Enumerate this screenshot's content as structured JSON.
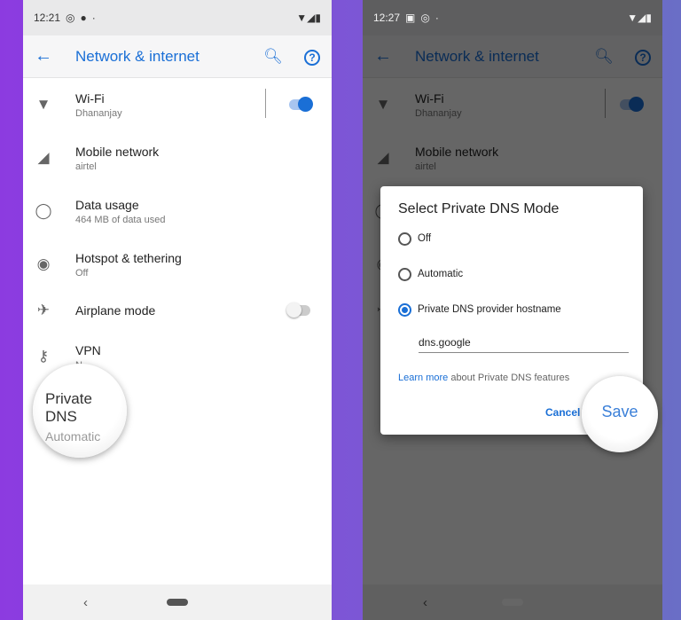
{
  "left_phone": {
    "status": {
      "time": "12:21"
    },
    "appbar": {
      "title": "Network & internet"
    },
    "items": [
      {
        "title": "Wi-Fi",
        "subtitle": "Dhananjay",
        "icon": "wifi-icon",
        "toggle": true
      },
      {
        "title": "Mobile network",
        "subtitle": "airtel",
        "icon": "signal-icon"
      },
      {
        "title": "Data usage",
        "subtitle": "464 MB of data used",
        "icon": "data-usage-icon"
      },
      {
        "title": "Hotspot & tethering",
        "subtitle": "Off",
        "icon": "hotspot-icon"
      },
      {
        "title": "Airplane mode",
        "icon": "airplane-icon",
        "toggle": false
      },
      {
        "title": "VPN",
        "subtitle": "N",
        "icon": "vpn-key-icon"
      }
    ],
    "magnifier": {
      "title": "Private DNS",
      "subtitle": "Automatic"
    }
  },
  "right_phone": {
    "status": {
      "time": "12:27"
    },
    "dialog": {
      "title": "Select Private DNS Mode",
      "options": [
        "Off",
        "Automatic",
        "Private DNS provider hostname"
      ],
      "selected": "Private DNS provider hostname",
      "hostname": "dns.google",
      "learn_more_link": "Learn more",
      "learn_more_text": " about Private DNS features",
      "cancel": "Cancel",
      "save": "Save"
    }
  },
  "colors": {
    "accent": "#1a6fd6"
  }
}
